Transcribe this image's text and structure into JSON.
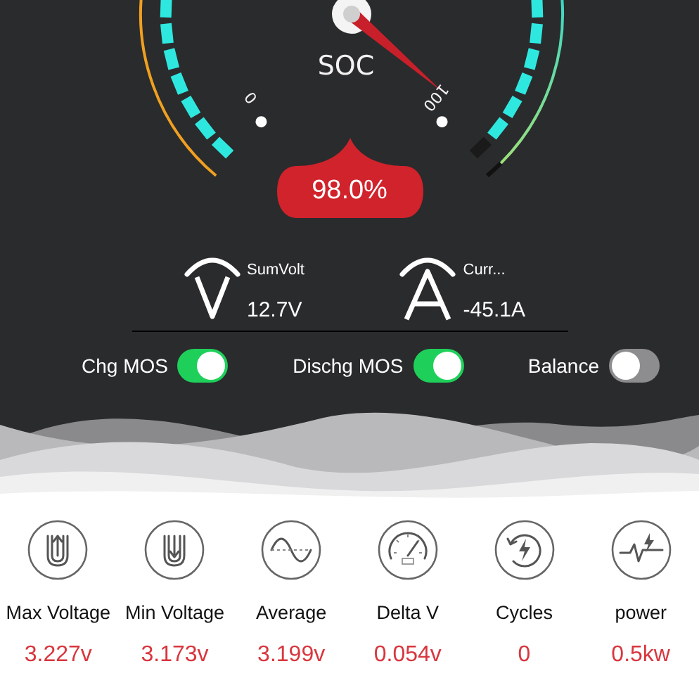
{
  "gauge": {
    "label": "SOC",
    "min_label": "0",
    "max_label": "100",
    "reading": "98.0%"
  },
  "readings": [
    {
      "kind": "volt",
      "label": "SumVolt",
      "value": "12.7V"
    },
    {
      "kind": "amp",
      "label": "Curr...",
      "value": "-45.1A"
    }
  ],
  "switches": [
    {
      "label": "Chg MOS",
      "on": true
    },
    {
      "label": "Dischg MOS",
      "on": true
    },
    {
      "label": "Balance",
      "on": false
    }
  ],
  "stats": [
    {
      "kind": "max",
      "label": "Max Voltage",
      "value": "3.227v"
    },
    {
      "kind": "min",
      "label": "Min Voltage",
      "value": "3.173v"
    },
    {
      "kind": "average",
      "label": "Average",
      "value": "3.199v"
    },
    {
      "kind": "delta",
      "label": "Delta V",
      "value": "0.054v"
    },
    {
      "kind": "cycles",
      "label": "Cycles",
      "value": "0"
    },
    {
      "kind": "power",
      "label": "power",
      "value": "0.5kw"
    }
  ]
}
